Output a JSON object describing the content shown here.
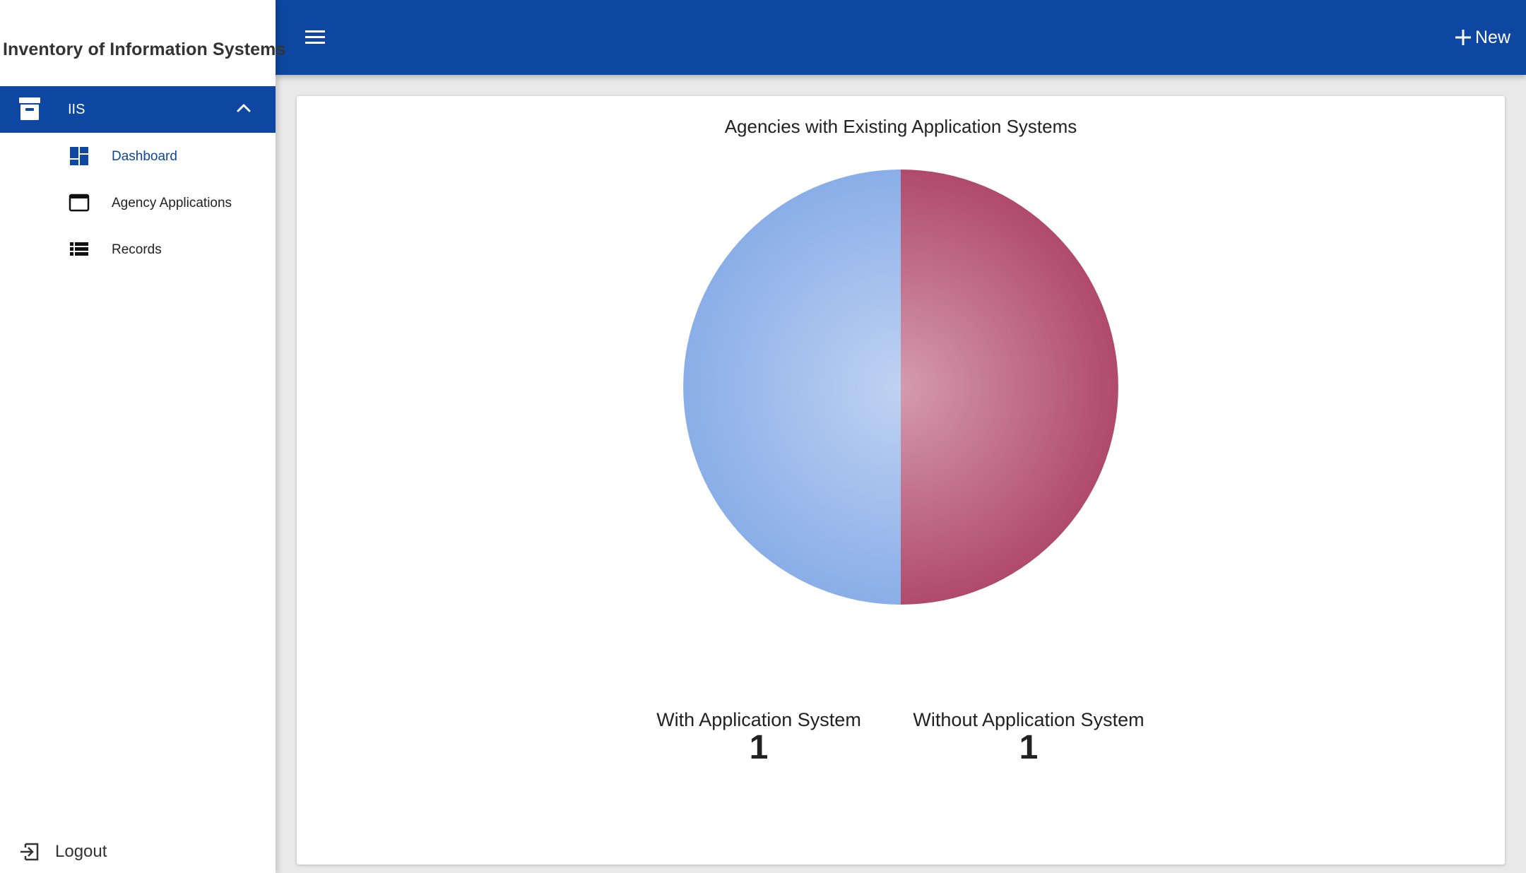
{
  "app": {
    "title": "Inventory of Information Systems"
  },
  "sidebar": {
    "group": {
      "label": "IIS",
      "icon": "archive-icon",
      "expanded": true
    },
    "items": [
      {
        "label": "Dashboard",
        "icon": "dashboard-icon",
        "active": true
      },
      {
        "label": "Agency Applications",
        "icon": "window-icon",
        "active": false
      },
      {
        "label": "Records",
        "icon": "list-icon",
        "active": false
      }
    ],
    "logout": {
      "label": "Logout",
      "icon": "logout-icon"
    }
  },
  "topbar": {
    "menu_icon": "menu-icon",
    "new_label": "New",
    "new_icon": "plus-icon"
  },
  "colors": {
    "brand": "#0e47a1",
    "series_with": "#8aaee8",
    "series_without": "#b04a6c"
  },
  "chart_data": {
    "type": "pie",
    "title": "Agencies with Existing Application Systems",
    "series": [
      {
        "name": "With Application System",
        "value": 1,
        "color": "#8aaee8"
      },
      {
        "name": "Without Application System",
        "value": 1,
        "color": "#b04a6c"
      }
    ]
  },
  "stats": [
    {
      "label": "With Application System",
      "value": "1"
    },
    {
      "label": "Without Application System",
      "value": "1"
    }
  ]
}
